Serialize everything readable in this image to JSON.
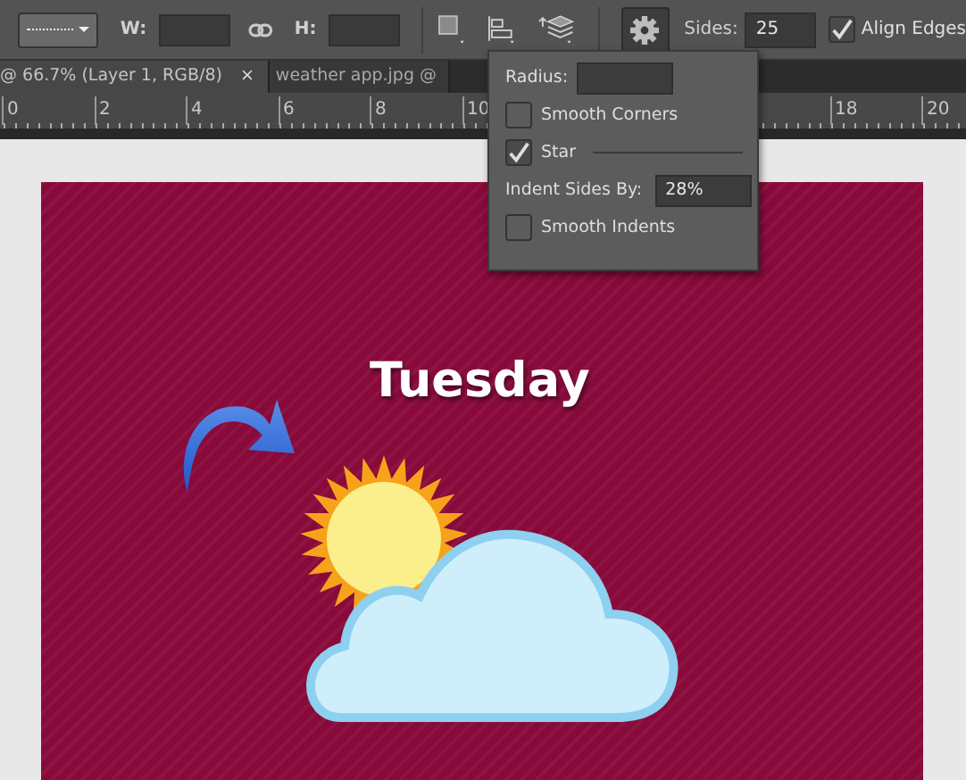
{
  "toolbar": {
    "width_label": "W:",
    "height_label": "H:",
    "sides_label": "Sides:",
    "sides": "25",
    "align_edges": {
      "label": "Align Edges",
      "checked": true
    }
  },
  "tabs": [
    {
      "label": "@ 66.7% (Layer 1, RGB/8)",
      "close": "×",
      "selected": true
    },
    {
      "label": "weather app.jpg @",
      "selected": false
    }
  ],
  "ruler": [
    "0",
    "2",
    "4",
    "6",
    "8",
    "10",
    "18",
    "20"
  ],
  "shape_options": {
    "radius_label": "Radius:",
    "options": [
      {
        "kind": "checkbox",
        "label": "Smooth Corners",
        "checked": false
      },
      {
        "kind": "checkbox-rule",
        "label": "Star",
        "checked": true
      },
      {
        "kind": "field",
        "label": "Indent Sides By:",
        "value": "28%"
      },
      {
        "kind": "checkbox",
        "label": "Smooth Indents",
        "checked": false
      }
    ]
  },
  "canvas": {
    "title": "Tuesday"
  }
}
